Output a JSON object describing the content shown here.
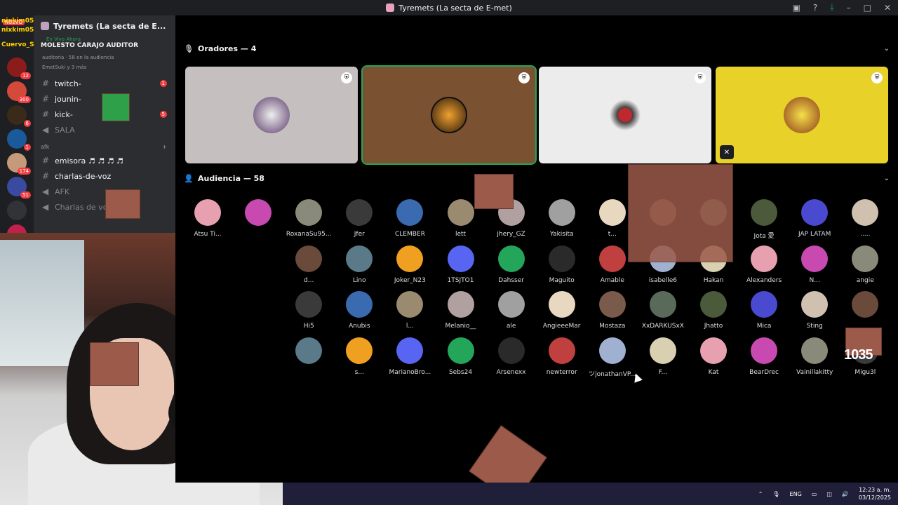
{
  "window": {
    "title": "Tyremets (La secta de E-met)"
  },
  "guild": {
    "name": "Tyremets (La secta de E...",
    "live_label": "En Vivo Ahora",
    "live_title": "MOLESTO CARAJO AUDITOR",
    "meta": "auditoria · 58 en la audiencia",
    "viewers": "EmetSuki y 3 más"
  },
  "chat_overlay": [
    {
      "user": "nixkim05:",
      "text": ""
    },
    {
      "user": "nixkim05:",
      "text": ""
    },
    {
      "user": "Cuervo_SL:",
      "text": ""
    }
  ],
  "servers": {
    "nuevo": "NUEVO",
    "badges": [
      "12",
      "300",
      "6",
      "1",
      "174",
      "51"
    ]
  },
  "channels": [
    {
      "name": "twitch-",
      "count": "1"
    },
    {
      "name": "jounin-",
      "count": ""
    },
    {
      "name": "kick-",
      "count": "5"
    },
    {
      "name": "SALA",
      "count": "",
      "muted": true
    }
  ],
  "category": {
    "name": "afk"
  },
  "channels2": [
    {
      "name": "emisora ♬ ♬ ♬ ♬"
    },
    {
      "name": "charlas-de-voz"
    },
    {
      "name": "AFK"
    },
    {
      "name": "Charlas de voz"
    }
  ],
  "stage": {
    "speakers_label": "Oradores — 4",
    "audience_label": "Audiencia — 58"
  },
  "speakers": [
    {
      "color": "#c6bfc0"
    },
    {
      "color": "#7a5232"
    },
    {
      "color": "#ececec"
    },
    {
      "color": "#e8d22a"
    }
  ],
  "audience": [
    [
      "Atsu Ti...",
      "",
      "RoxanaSu95...",
      "Jfer",
      "CLEMBER",
      "lett",
      "jhery_GZ",
      "Yakisita",
      "t...",
      "",
      "",
      "Jota 愛",
      "JAP LATAM",
      "....."
    ],
    [
      "d...",
      "Lino",
      "Joker_N23",
      "1TSJTO1",
      "Dahsser",
      "Maguito",
      "Amable",
      "isabelle6",
      "Hakan",
      "Alexanders",
      "N...",
      "angie"
    ],
    [
      "Hi5",
      "Anubis",
      "l...",
      "Melanio__",
      "ale",
      "AngieeeMar",
      "Mostaza",
      "XxDARKUSxX",
      "Jhatto",
      "Mica",
      "Sting",
      ""
    ],
    [
      "",
      "s...",
      "MarianoBro...",
      "Sebs24",
      "Arsenexx",
      "newterror",
      "ツjonathanVP...",
      "F...",
      "Kat",
      "BearDrec",
      "Vainillakitty",
      "Migu3l"
    ]
  ],
  "overlay_number": "1035",
  "taskbar": {
    "lang": "ENG",
    "time": "12:23 a. m.",
    "date": "03/12/2025"
  },
  "colors": {
    "accent": "#23a55a",
    "danger": "#f23f43",
    "discord": "#5865f2",
    "orange": "#f0a020"
  }
}
